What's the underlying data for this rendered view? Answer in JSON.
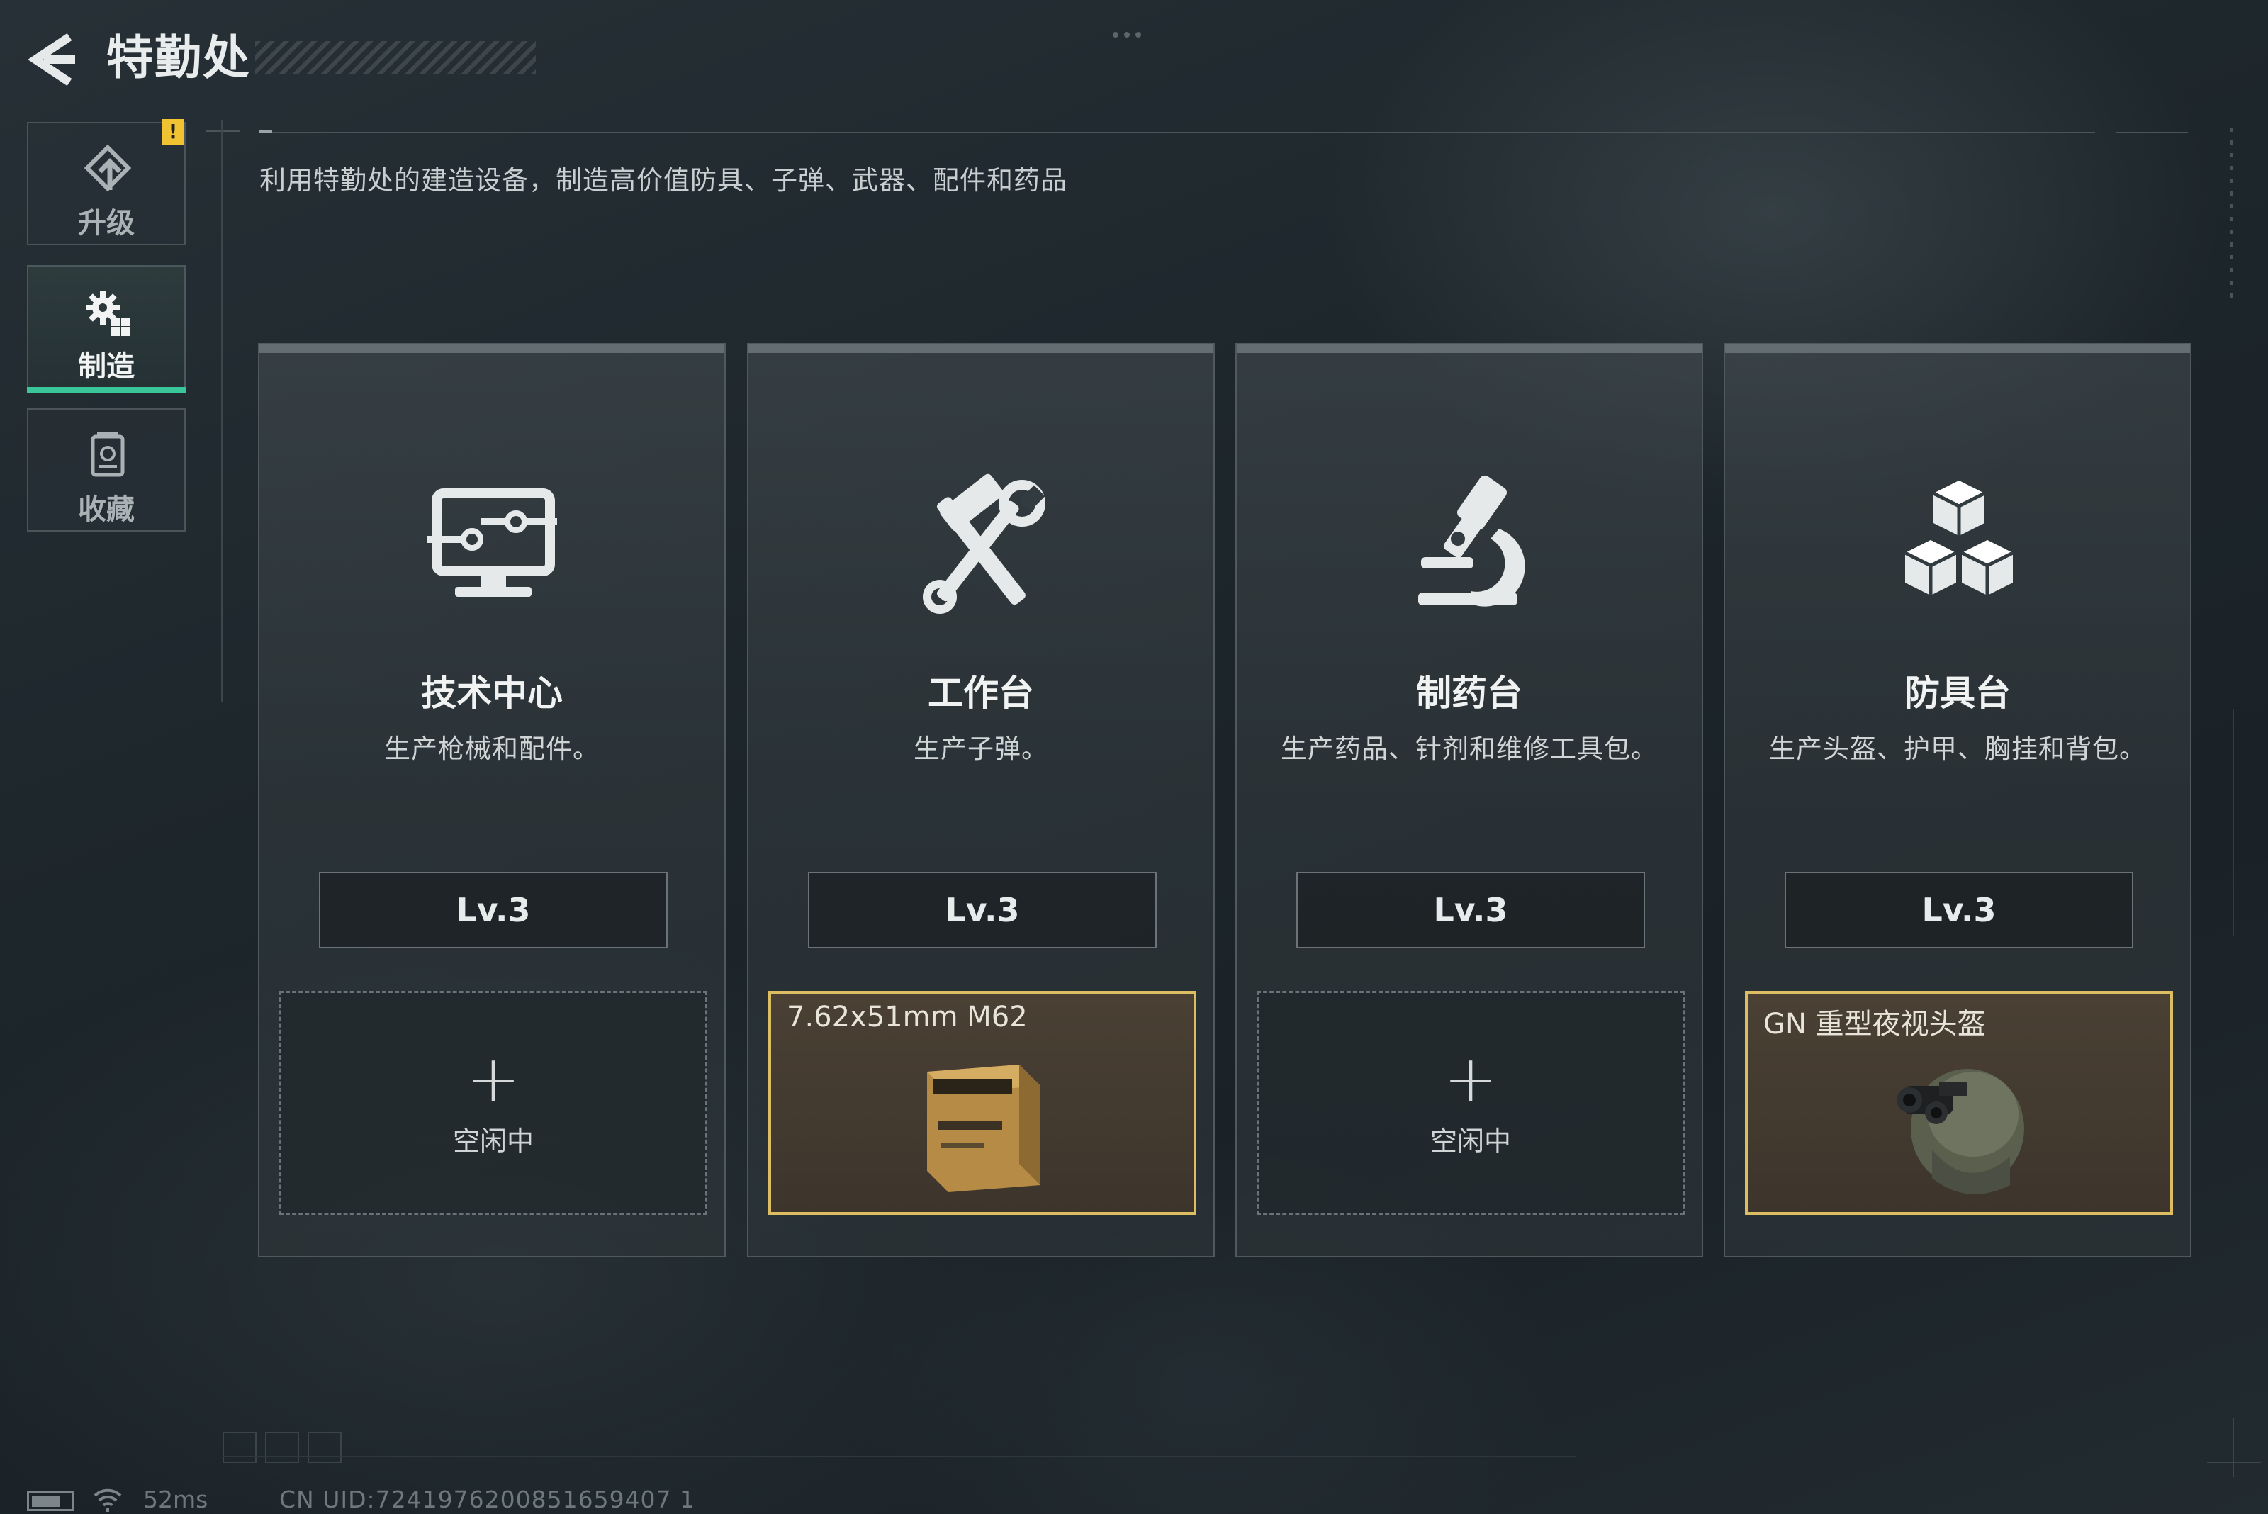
{
  "header": {
    "title": "特勤处",
    "description": "利用特勤处的建造设备，制造高价值防具、子弹、武器、配件和药品"
  },
  "sidebar": {
    "badge": "!",
    "items": [
      {
        "label": "升级",
        "icon": "upgrade-icon",
        "active": false
      },
      {
        "label": "制造",
        "icon": "gears-icon",
        "active": true
      },
      {
        "label": "收藏",
        "icon": "collection-icon",
        "active": false
      }
    ]
  },
  "stations": [
    {
      "name": "技术中心",
      "desc": "生产枪械和配件。",
      "level": "Lv.3",
      "icon": "monitor-circuit-icon",
      "slot": {
        "state": "idle",
        "plus": "+",
        "label": "空闲中"
      }
    },
    {
      "name": "工作台",
      "desc": "生产子弹。",
      "level": "Lv.3",
      "icon": "hammer-wrench-icon",
      "slot": {
        "state": "crafting",
        "item": "7.62x51mm M62",
        "thumb": "ammo-box-icon"
      }
    },
    {
      "name": "制药台",
      "desc": "生产药品、针剂和维修工具包。",
      "level": "Lv.3",
      "icon": "microscope-icon",
      "slot": {
        "state": "idle",
        "plus": "+",
        "label": "空闲中"
      }
    },
    {
      "name": "防具台",
      "desc": "生产头盔、护甲、胸挂和背包。",
      "level": "Lv.3",
      "icon": "cubes-icon",
      "slot": {
        "state": "crafting",
        "item": "GN 重型夜视头盔",
        "thumb": "night-vision-helmet-icon"
      }
    }
  ],
  "status": {
    "ping": "52ms",
    "uid": "CN UID:7241976200851659407 1"
  },
  "colors": {
    "accent": "#39c79a",
    "highlight": "#dcbd62",
    "badge": "#f1c232"
  }
}
